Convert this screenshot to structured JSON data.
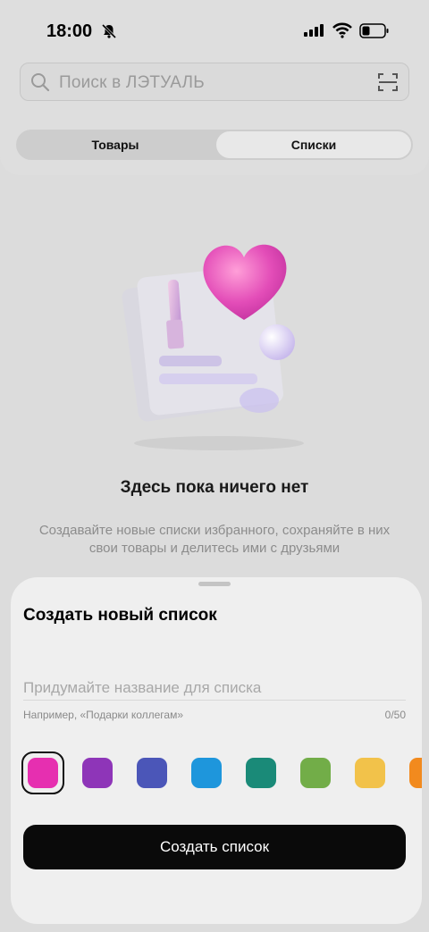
{
  "status_bar": {
    "time": "18:00"
  },
  "search": {
    "placeholder": "Поиск в ЛЭТУАЛЬ"
  },
  "tabs": [
    {
      "label": "Товары",
      "active": false
    },
    {
      "label": "Списки",
      "active": true
    }
  ],
  "empty_state": {
    "title": "Здесь пока ничего нет",
    "description": "Создавайте новые списки избранного, сохраняйте в них свои товары и делитесь ими с друзьями"
  },
  "sheet": {
    "title": "Создать новый список",
    "input_placeholder": "Придумайте название для списка",
    "input_value": "",
    "hint": "Например, «Подарки коллегам»",
    "counter": "0/50",
    "colors": [
      "#e62fb0",
      "#8e35b8",
      "#4b56b8",
      "#1e96dc",
      "#1a8a78",
      "#72ad48",
      "#f2c24a",
      "#f28a1e"
    ],
    "selected_color_index": 0,
    "create_button": "Создать список"
  }
}
